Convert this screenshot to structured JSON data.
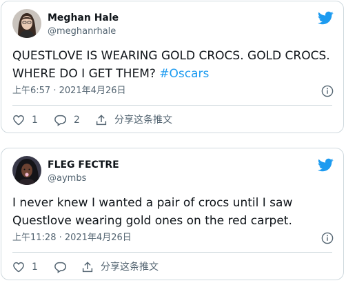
{
  "tweets": [
    {
      "name": "Meghan Hale",
      "handle": "@meghanrhale",
      "text_lines": [
        "QUESTLOVE IS WEARING GOLD CROCS. GOLD CROCS.",
        "WHERE DO I GET THEM? "
      ],
      "hashtag": "#Oscars",
      "timestamp": "上午6:57 · 2021年4月26日",
      "like_count": "1",
      "reply_count": "2",
      "share_label": "分享这条推文"
    },
    {
      "name": "FLEG FECTRE",
      "handle": "@aymbs",
      "text_lines": [
        "I never knew I wanted a pair of crocs until I saw",
        "Questlove wearing gold ones on the red carpet."
      ],
      "hashtag": "",
      "timestamp": "上午11:28 · 2021年4月26日",
      "like_count": "1",
      "reply_count": "",
      "share_label": "分享这条推文"
    }
  ],
  "colors": {
    "twitter_blue": "#1d9bf0",
    "secondary_text": "#536471",
    "border": "#cfd9de",
    "text": "#0f1419"
  },
  "icons": [
    "twitter-bird-icon",
    "info-icon",
    "heart-icon",
    "reply-icon",
    "share-icon"
  ]
}
